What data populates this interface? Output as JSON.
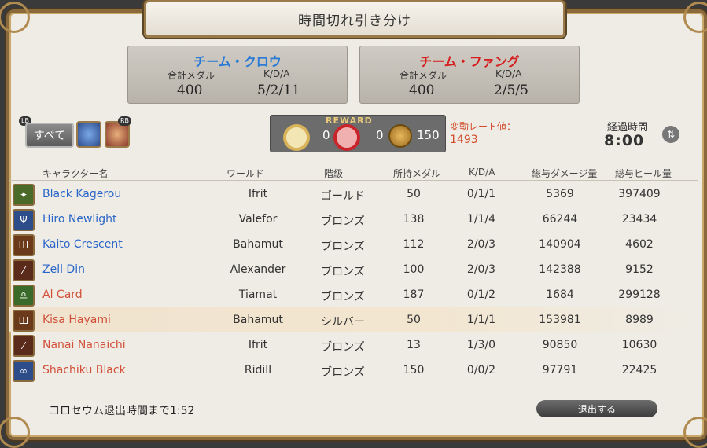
{
  "window": {
    "title": "時間切れ引き分け"
  },
  "team_a": {
    "name": "チーム・クロウ",
    "name_color": "#2a7ad6",
    "medals_label": "合計メダル",
    "kda_label": "K/D/A",
    "medals": "400",
    "kda": "5/2/11"
  },
  "team_b": {
    "name": "チーム・ファング",
    "name_color": "#d61e1e",
    "medals_label": "合計メダル",
    "kda_label": "K/D/A",
    "medals": "400",
    "kda": "2/5/5"
  },
  "filters": {
    "all_label": "すべて",
    "lb_tag": "LB",
    "rb_tag": "RB"
  },
  "reward": {
    "title": "REWARD",
    "items": [
      {
        "icon": "gold-medal-outline-icon",
        "count": "0"
      },
      {
        "icon": "red-medal-icon",
        "count": "0"
      },
      {
        "icon": "bronze-coin-icon",
        "count": "150"
      }
    ]
  },
  "rate": {
    "label": "変動レート値：",
    "value": "1493"
  },
  "elapsed": {
    "label": "経過時間",
    "value": "8:00"
  },
  "table": {
    "headers": [
      "キャラクター名",
      "ワールド",
      "階級",
      "所持メダル",
      "K/D/A",
      "総与ダメージ量",
      "総与ヒール量"
    ],
    "rows": [
      {
        "job_icon": "astrologian-icon",
        "name": "Black Kagerou",
        "team": "a",
        "world": "Ifrit",
        "rank": "ゴールド",
        "medals": "50",
        "kda": "0/1/1",
        "damage": "5369",
        "heal": "397409"
      },
      {
        "job_icon": "paladin-icon",
        "name": "Hiro Newlight",
        "team": "a",
        "world": "Valefor",
        "rank": "ブロンズ",
        "medals": "138",
        "kda": "1/1/4",
        "damage": "66244",
        "heal": "23434"
      },
      {
        "job_icon": "warrior-icon",
        "name": "Kaito Crescent",
        "team": "a",
        "world": "Bahamut",
        "rank": "ブロンズ",
        "medals": "112",
        "kda": "2/0/3",
        "damage": "140904",
        "heal": "4602"
      },
      {
        "job_icon": "dragoon-icon",
        "name": "Zell Din",
        "team": "a",
        "world": "Alexander",
        "rank": "ブロンズ",
        "medals": "100",
        "kda": "2/0/3",
        "damage": "142388",
        "heal": "9152"
      },
      {
        "job_icon": "scholar-icon",
        "name": "Al Card",
        "team": "b",
        "world": "Tiamat",
        "rank": "ブロンズ",
        "medals": "187",
        "kda": "0/1/2",
        "damage": "1684",
        "heal": "299128"
      },
      {
        "job_icon": "warrior-icon",
        "name": "Kisa Hayami",
        "team": "b",
        "world": "Bahamut",
        "rank": "シルバー",
        "medals": "50",
        "kda": "1/1/1",
        "damage": "153981",
        "heal": "8989",
        "highlight": true
      },
      {
        "job_icon": "dragoon-icon",
        "name": "Nanai Nanaichi",
        "team": "b",
        "world": "Ifrit",
        "rank": "ブロンズ",
        "medals": "13",
        "kda": "1/3/0",
        "damage": "90850",
        "heal": "10630"
      },
      {
        "job_icon": "ninja-icon",
        "name": "Shachiku Black",
        "team": "b",
        "world": "Ridill",
        "rank": "ブロンズ",
        "medals": "150",
        "kda": "0/0/2",
        "damage": "97791",
        "heal": "22425"
      }
    ]
  },
  "footer": {
    "countdown_text": "コロセウム退出時間まで1:52",
    "exit_label": "退出する"
  }
}
